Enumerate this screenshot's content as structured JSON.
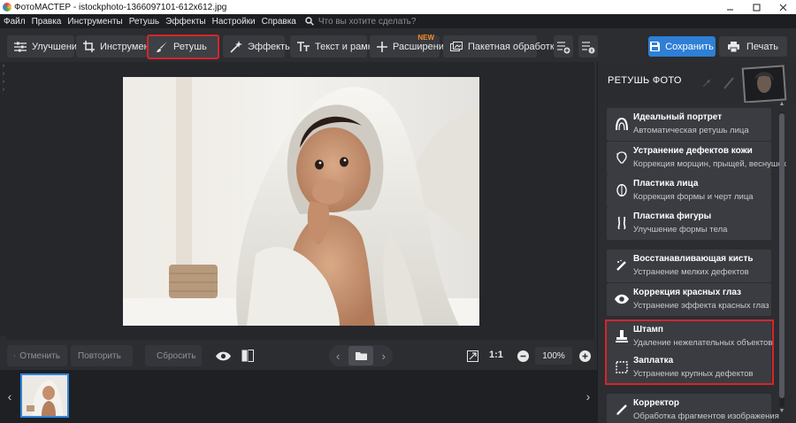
{
  "window": {
    "title": "ФотоМАСТЕР - istockphoto-1366097101-612x612.jpg"
  },
  "menu": {
    "items": [
      "Файл",
      "Правка",
      "Инструменты",
      "Ретушь",
      "Эффекты",
      "Настройки",
      "Справка"
    ],
    "search_placeholder": "Что вы хотите сделать?"
  },
  "toolbar": {
    "tabs": [
      {
        "label": "Улучшения",
        "icon": "sliders-icon",
        "active": false
      },
      {
        "label": "Инструменты",
        "icon": "crop-icon",
        "active": false
      },
      {
        "label": "Ретушь",
        "icon": "brush-icon",
        "active": true
      },
      {
        "label": "Эффекты",
        "icon": "magic-wand-icon",
        "active": false
      },
      {
        "label": "Текст и рамки",
        "icon": "text-icon",
        "active": false
      },
      {
        "label": "Расширения",
        "icon": "plus-icon",
        "active": false,
        "badge": "NEW"
      },
      {
        "label": "Пакетная обработка",
        "icon": "batch-icon",
        "active": false
      }
    ],
    "save_label": "Сохранить",
    "print_label": "Печать"
  },
  "bottom": {
    "undo_label": "Отменить",
    "redo_label": "Повторить",
    "reset_label": "Сбросить",
    "ratio_label": "1:1",
    "zoom_value": "100%"
  },
  "panel": {
    "title": "РЕТУШЬ ФОТО",
    "tools": [
      {
        "title": "Идеальный портрет",
        "subtitle": "Автоматическая ретушь лица",
        "icon": "portrait-icon"
      },
      {
        "title": "Устранение дефектов кожи",
        "subtitle": "Коррекция морщин, прыщей, веснушек",
        "icon": "skin-icon"
      },
      {
        "title": "Пластика лица",
        "subtitle": "Коррекция формы и черт лица",
        "icon": "face-icon"
      },
      {
        "title": "Пластика фигуры",
        "subtitle": "Улучшение формы тела",
        "icon": "figure-icon"
      },
      {
        "title": "Восстанавливающая кисть",
        "subtitle": "Устранение мелких дефектов",
        "icon": "healing-brush-icon"
      },
      {
        "title": "Коррекция красных глаз",
        "subtitle": "Устранение эффекта красных глаз",
        "icon": "eye-icon"
      },
      {
        "title": "Штамп",
        "subtitle": "Удаление нежелательных объектов",
        "icon": "stamp-icon"
      },
      {
        "title": "Заплатка",
        "subtitle": "Устранение крупных дефектов",
        "icon": "patch-icon"
      },
      {
        "title": "Корректор",
        "subtitle": "Обработка фрагментов изображения",
        "icon": "corrector-icon"
      }
    ]
  },
  "colors": {
    "accent_blue": "#2e7fd6",
    "highlight_red": "#d6252b",
    "new_badge_orange": "#f08a24"
  }
}
